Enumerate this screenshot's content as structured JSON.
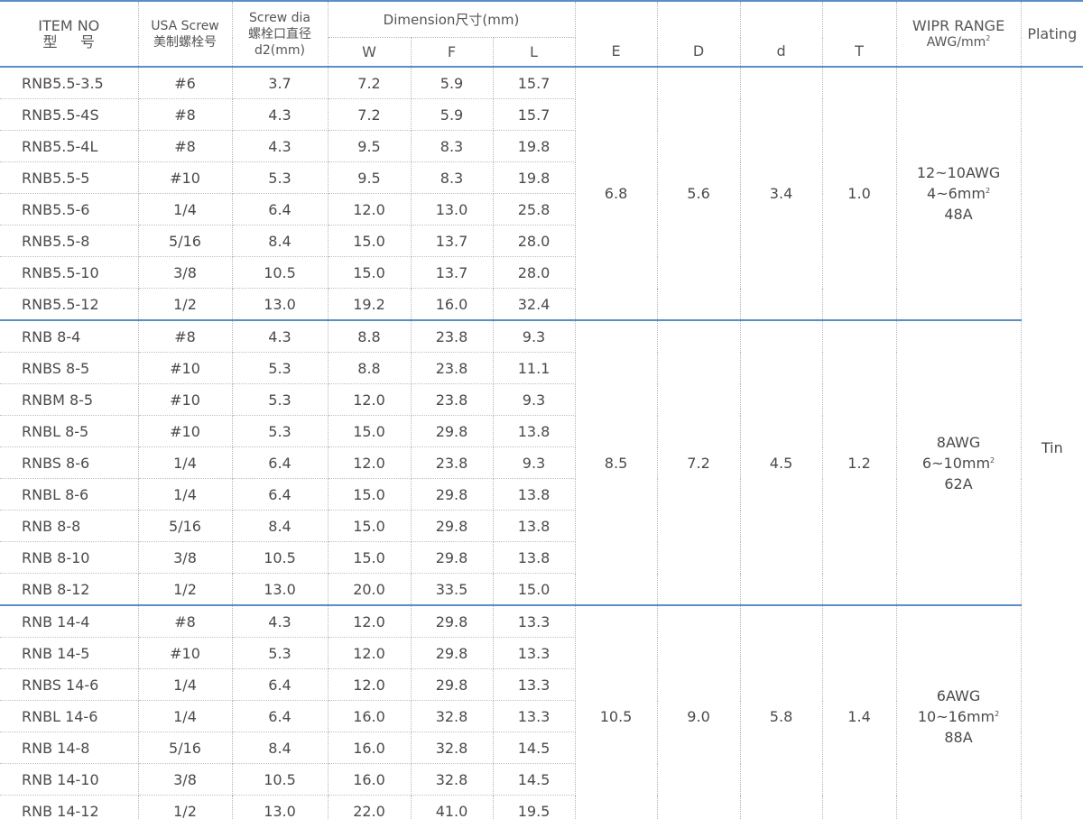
{
  "header": {
    "item_no": [
      "ITEM NO",
      "型     号"
    ],
    "usa_screw": [
      "USA Screw",
      "美制螺栓号"
    ],
    "screw_dia": [
      "Screw dia",
      "螺栓口直径",
      "d2(mm)"
    ],
    "dimension": "Dimension尺寸(mm)",
    "dim_cols": [
      "W",
      "F",
      "L"
    ],
    "other_cols": [
      "E",
      "D",
      "d",
      "T"
    ],
    "wipr": [
      "WIPR RANGE",
      "AWG/mm",
      "2"
    ],
    "plating": "Plating"
  },
  "groups": [
    {
      "rows": [
        [
          "RNB5.5-3.5",
          "#6",
          "3.7",
          "7.2",
          "5.9",
          "15.7"
        ],
        [
          "RNB5.5-4S",
          "#8",
          "4.3",
          "7.2",
          "5.9",
          "15.7"
        ],
        [
          "RNB5.5-4L",
          "#8",
          "4.3",
          "9.5",
          "8.3",
          "19.8"
        ],
        [
          "RNB5.5-5",
          "#10",
          "5.3",
          "9.5",
          "8.3",
          "19.8"
        ],
        [
          "RNB5.5-6",
          "1/4",
          "6.4",
          "12.0",
          "13.0",
          "25.8"
        ],
        [
          "RNB5.5-8",
          "5/16",
          "8.4",
          "15.0",
          "13.7",
          "28.0"
        ],
        [
          "RNB5.5-10",
          "3/8",
          "10.5",
          "15.0",
          "13.7",
          "28.0"
        ],
        [
          "RNB5.5-12",
          "1/2",
          "13.0",
          "19.2",
          "16.0",
          "32.4"
        ]
      ],
      "E": "6.8",
      "D": "5.6",
      "d": "3.4",
      "T": "1.0",
      "wipr": {
        "awg": "12~10AWG",
        "mm": "4~6mm",
        "sup": "2",
        "amp": "48A"
      }
    },
    {
      "rows": [
        [
          "RNB 8-4",
          "#8",
          "4.3",
          "8.8",
          "23.8",
          "9.3"
        ],
        [
          "RNBS 8-5",
          "#10",
          "5.3",
          "8.8",
          "23.8",
          "11.1"
        ],
        [
          "RNBM 8-5",
          "#10",
          "5.3",
          "12.0",
          "23.8",
          "9.3"
        ],
        [
          "RNBL 8-5",
          "#10",
          "5.3",
          "15.0",
          "29.8",
          "13.8"
        ],
        [
          "RNBS 8-6",
          "1/4",
          "6.4",
          "12.0",
          "23.8",
          "9.3"
        ],
        [
          "RNBL 8-6",
          "1/4",
          "6.4",
          "15.0",
          "29.8",
          "13.8"
        ],
        [
          "RNB 8-8",
          "5/16",
          "8.4",
          "15.0",
          "29.8",
          "13.8"
        ],
        [
          "RNB 8-10",
          "3/8",
          "10.5",
          "15.0",
          "29.8",
          "13.8"
        ],
        [
          "RNB 8-12",
          "1/2",
          "13.0",
          "20.0",
          "33.5",
          "15.0"
        ]
      ],
      "E": "8.5",
      "D": "7.2",
      "d": "4.5",
      "T": "1.2",
      "wipr": {
        "awg": "8AWG",
        "mm": "6~10mm",
        "sup": "2",
        "amp": "62A"
      }
    },
    {
      "rows": [
        [
          "RNB 14-4",
          "#8",
          "4.3",
          "12.0",
          "29.8",
          "13.3"
        ],
        [
          "RNB 14-5",
          "#10",
          "5.3",
          "12.0",
          "29.8",
          "13.3"
        ],
        [
          "RNBS 14-6",
          "1/4",
          "6.4",
          "12.0",
          "29.8",
          "13.3"
        ],
        [
          "RNBL 14-6",
          "1/4",
          "6.4",
          "16.0",
          "32.8",
          "13.3"
        ],
        [
          "RNB 14-8",
          "5/16",
          "8.4",
          "16.0",
          "32.8",
          "14.5"
        ],
        [
          "RNB 14-10",
          "3/8",
          "10.5",
          "16.0",
          "32.8",
          "14.5"
        ],
        [
          "RNB 14-12",
          "1/2",
          "13.0",
          "22.0",
          "41.0",
          "19.5"
        ]
      ],
      "E": "10.5",
      "D": "9.0",
      "d": "5.8",
      "T": "1.4",
      "wipr": {
        "awg": "6AWG",
        "mm": "10~16mm",
        "sup": "2",
        "amp": "88A"
      }
    }
  ],
  "plating_value": "Tin",
  "colors": {
    "rule": "#5b8fc4",
    "text": "#444444",
    "dotted": "#b5b5b5"
  }
}
